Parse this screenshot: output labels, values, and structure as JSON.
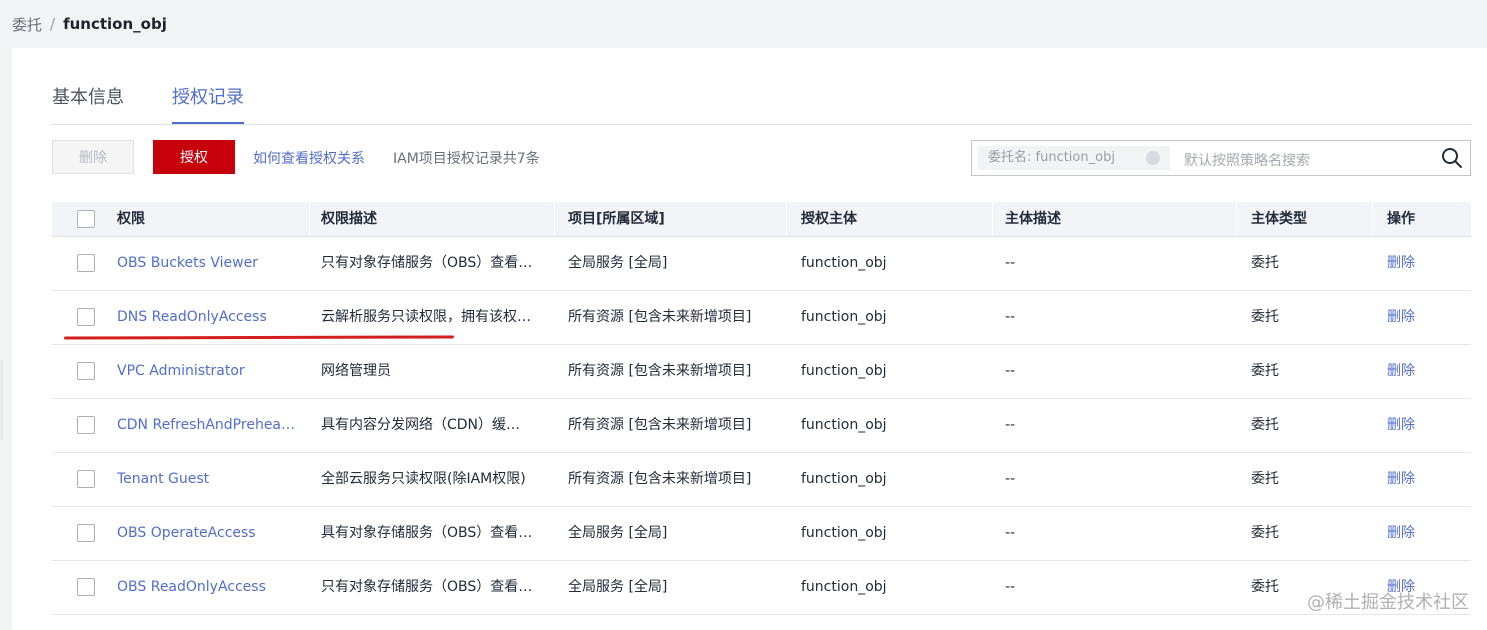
{
  "breadcrumb": {
    "parent": "委托",
    "separator": "/",
    "current": "function_obj"
  },
  "tabs": [
    {
      "label": "基本信息",
      "active": false
    },
    {
      "label": "授权记录",
      "active": true
    }
  ],
  "toolbar": {
    "delete_label": "删除",
    "grant_label": "授权",
    "help_link": "如何查看授权关系",
    "count_text": "IAM项目授权记录共7条"
  },
  "search": {
    "tag_label": "委托名: function_obj",
    "placeholder": "默认按照策略名搜索",
    "icon": "search-icon"
  },
  "table": {
    "columns": [
      "权限",
      "权限描述",
      "项目[所属区域]",
      "授权主体",
      "主体描述",
      "主体类型",
      "操作"
    ],
    "rows": [
      {
        "name": "OBS Buckets Viewer",
        "desc": "只有对象存储服务（OBS）查看桶列表的权限",
        "project": "全局服务 [全局]",
        "subject": "function_obj",
        "subject_desc": "--",
        "type": "委托",
        "op": "删除"
      },
      {
        "name": "DNS ReadOnlyAccess",
        "desc": "云解析服务只读权限，拥有该权限的用户",
        "project": "所有资源 [包含未来新增项目]",
        "subject": "function_obj",
        "subject_desc": "--",
        "type": "委托",
        "op": "删除"
      },
      {
        "name": "VPC Administrator",
        "desc": "网络管理员",
        "project": "所有资源 [包含未来新增项目]",
        "subject": "function_obj",
        "subject_desc": "--",
        "type": "委托",
        "op": "删除"
      },
      {
        "name": "CDN RefreshAndPreheatAccess",
        "desc": "具有内容分发网络（CDN）缓存刷新和预热的权限",
        "project": "所有资源 [包含未来新增项目]",
        "subject": "function_obj",
        "subject_desc": "--",
        "type": "委托",
        "op": "删除"
      },
      {
        "name": "Tenant Guest",
        "desc": "全部云服务只读权限(除IAM权限)",
        "project": "所有资源 [包含未来新增项目]",
        "subject": "function_obj",
        "subject_desc": "--",
        "type": "委托",
        "op": "删除"
      },
      {
        "name": "OBS OperateAccess",
        "desc": "具有对象存储服务（OBS）查看桶列表等的权限",
        "project": "全局服务 [全局]",
        "subject": "function_obj",
        "subject_desc": "--",
        "type": "委托",
        "op": "删除"
      },
      {
        "name": "OBS ReadOnlyAccess",
        "desc": "只有对象存储服务（OBS）查看桶列表的权限",
        "project": "全局服务 [全局]",
        "subject": "function_obj",
        "subject_desc": "--",
        "type": "委托",
        "op": "删除"
      }
    ]
  },
  "watermark": "@稀土掘金技术社区",
  "colors": {
    "accent": "#526ecc",
    "primary_button": "#c7000b",
    "annotation": "#d41f1f"
  }
}
